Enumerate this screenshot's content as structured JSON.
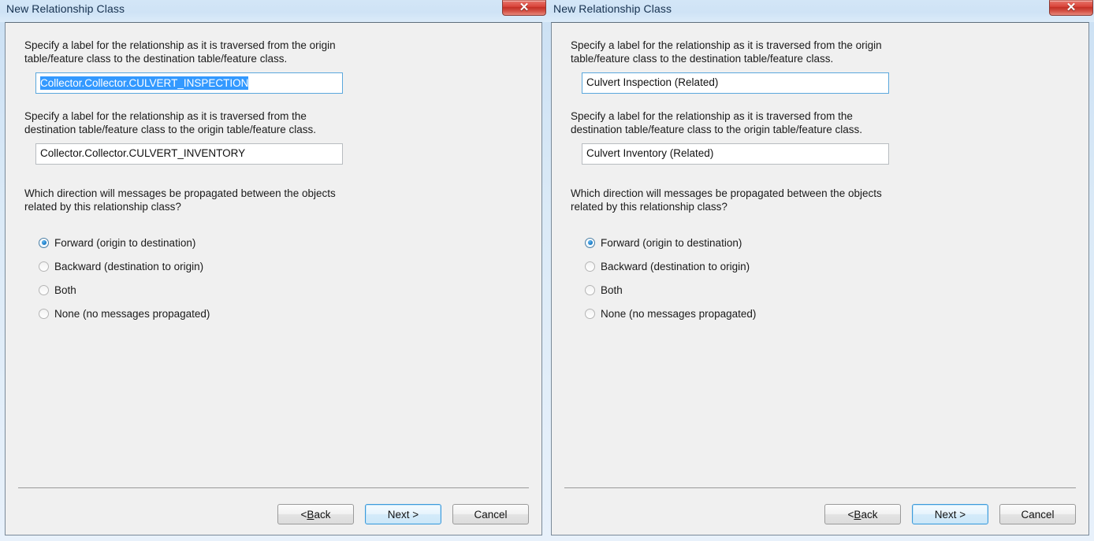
{
  "windows": [
    {
      "title": "New Relationship Class",
      "close_glyph": "✕",
      "close_name": "close-button",
      "forward_prompt": "Specify a label for the relationship as it is traversed from the origin table/feature class to the destination table/feature class.",
      "forward_value": "Collector.Collector.CULVERT_INSPECTION",
      "forward_selected": true,
      "forward_focused": true,
      "backward_prompt": "Specify a label for the relationship as it is traversed from the destination table/feature class to the origin table/feature class.",
      "backward_value": "Collector.Collector.CULVERT_INVENTORY",
      "question": "Which direction will messages be propagated between the objects related by this relationship class?",
      "radios": [
        {
          "label": "Forward (origin to destination)",
          "checked": true
        },
        {
          "label": "Backward (destination to origin)",
          "checked": false
        },
        {
          "label": "Both",
          "checked": false
        },
        {
          "label": "None (no messages propagated)",
          "checked": false
        }
      ],
      "buttons": {
        "back": "< Back",
        "back_accel_prefix": "< ",
        "back_accel_char": "B",
        "back_accel_suffix": "ack",
        "next": "Next >",
        "cancel": "Cancel"
      }
    },
    {
      "title": "New Relationship Class",
      "close_glyph": "✕",
      "close_name": "close-button",
      "forward_prompt": "Specify a label for the relationship as it is traversed from the origin table/feature class to the destination table/feature class.",
      "forward_value": "Culvert Inspection (Related)",
      "forward_selected": false,
      "forward_focused": true,
      "backward_prompt": "Specify a label for the relationship as it is traversed from the destination table/feature class to the origin table/feature class.",
      "backward_value": "Culvert Inventory (Related)",
      "question": "Which direction will messages be propagated between the objects related by this relationship class?",
      "radios": [
        {
          "label": "Forward (origin to destination)",
          "checked": true
        },
        {
          "label": "Backward (destination to origin)",
          "checked": false
        },
        {
          "label": "Both",
          "checked": false
        },
        {
          "label": "None (no messages propagated)",
          "checked": false
        }
      ],
      "buttons": {
        "back": "< Back",
        "back_accel_prefix": "< ",
        "back_accel_char": "B",
        "back_accel_suffix": "ack",
        "next": "Next >",
        "cancel": "Cancel"
      }
    }
  ],
  "colors": {
    "accent_blue": "#3399ff",
    "title_text": "#16314f",
    "close_red": "#d9443a",
    "dialog_bg": "#f0f0f0",
    "default_button_border": "#3c9adb"
  }
}
